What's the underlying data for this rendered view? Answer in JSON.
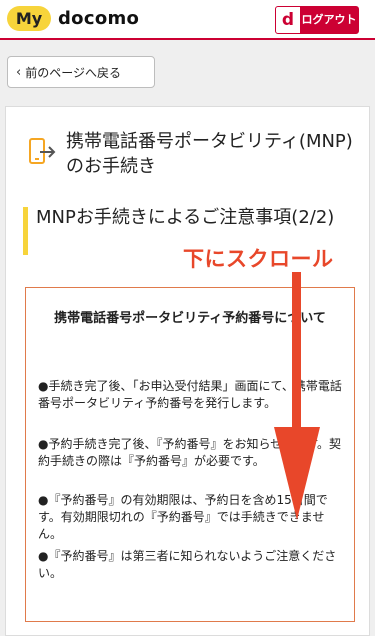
{
  "header": {
    "logo_my": "My",
    "logo_docomo": "docomo",
    "logout_d": "d",
    "logout_label": "ログアウト"
  },
  "back": {
    "label": "前のページへ戻る",
    "icon": "chevron-left-icon"
  },
  "page": {
    "title": "携帯電話番号ポータビリティ(MNP)のお手続き",
    "title_icon": "phone-transfer-icon",
    "section_title": "MNPお手続きによるご注意事項(2/2)"
  },
  "notice": {
    "heading": "携帯電話番号ポータビリティ予約番号について",
    "bullets": [
      "●手続き完了後、「お申込受付結果」画面にて、携帯電話番号ポータビリティ予約番号を発行します。",
      "●予約手続き完了後、『予約番号』をお知らせします。契約手続きの際は『予約番号』が必要です。",
      "●『予約番号』の有効期限は、予約日を含め15日間です。有効期限切れの『予約番号』では手続きできません。",
      "●『予約番号』は第三者に知られないようご注意ください。"
    ]
  },
  "overlay": {
    "scroll_label": "下にスクロール",
    "arrow_color": "#e8472a"
  },
  "colors": {
    "brand_red": "#cc0033",
    "brand_yellow": "#f7d43b",
    "notice_border": "#e07a4b"
  }
}
